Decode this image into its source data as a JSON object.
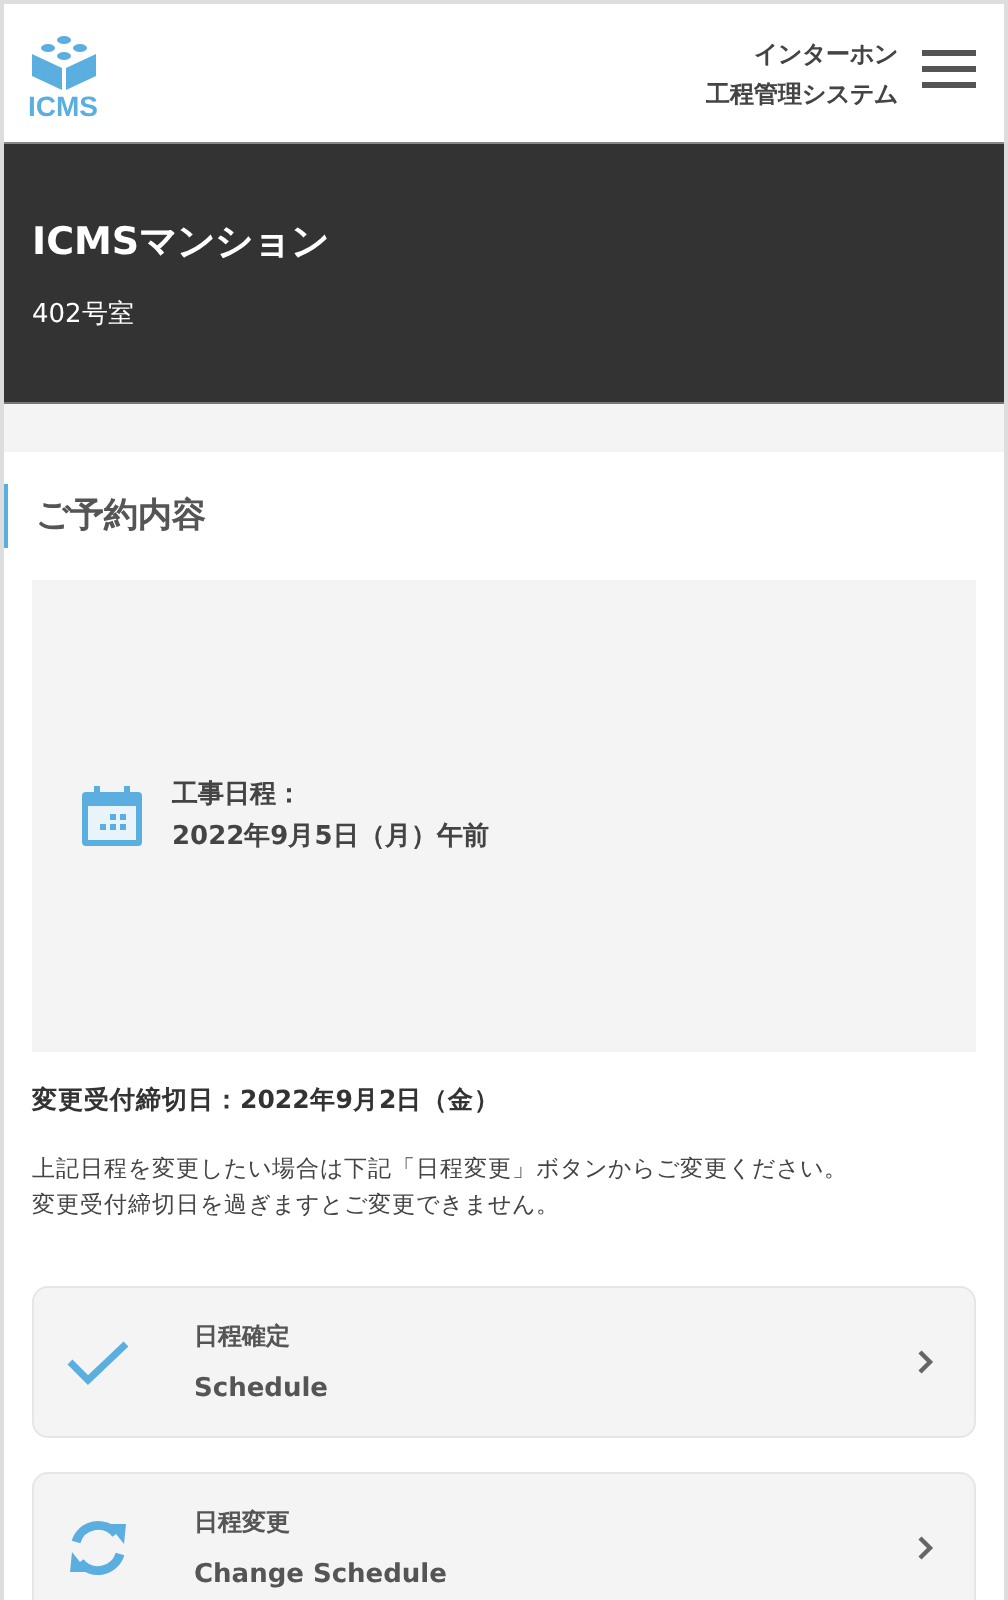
{
  "header": {
    "logo_text": "ICMS",
    "title_lines": [
      "インターホン",
      "工程管理システム"
    ]
  },
  "property": {
    "name": "ICMSマンション",
    "room": "402号室"
  },
  "reservation": {
    "heading": "ご予約内容",
    "schedule_label": "工事日程：",
    "schedule_value": "2022年9月5日（月）午前",
    "deadline": "変更受付締切日：2022年9月2日（金）",
    "notes": [
      "上記日程を変更したい場合は下記「日程変更」ボタンからご変更ください。",
      "変更受付締切日を過ぎますとご変更できません。"
    ]
  },
  "actions": [
    {
      "kind": "confirm",
      "label": "日程確定",
      "sublabel": "Schedule"
    },
    {
      "kind": "change",
      "label": "日程変更",
      "sublabel": "Change Schedule"
    }
  ]
}
